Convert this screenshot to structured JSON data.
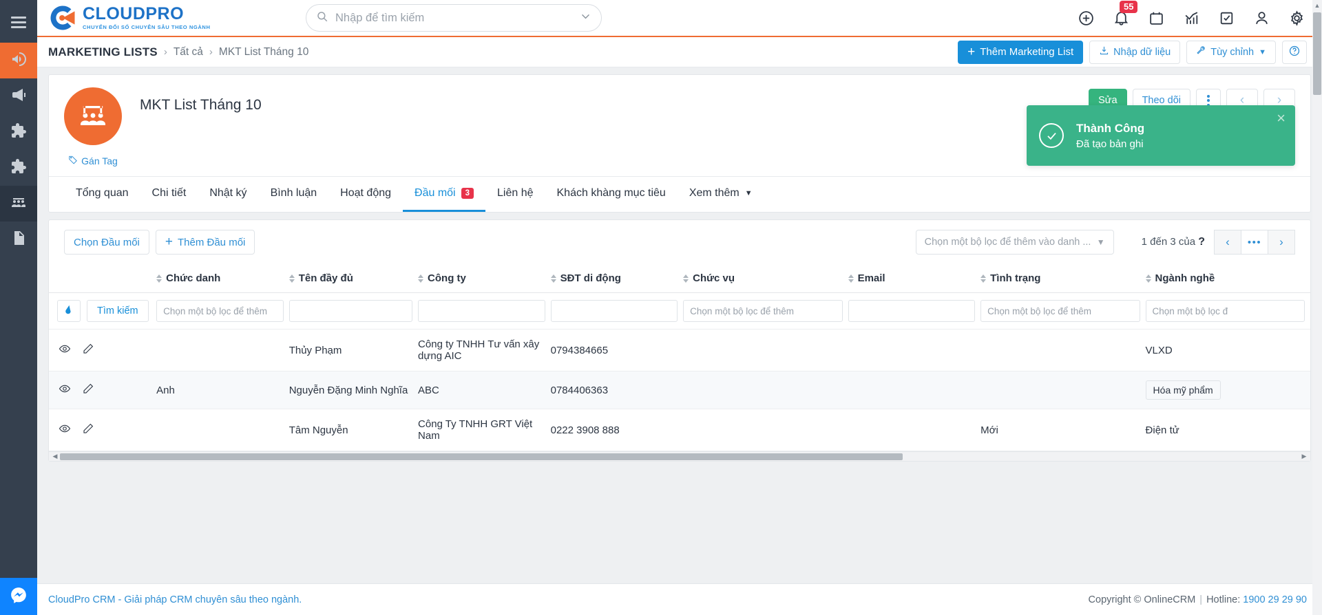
{
  "brand": {
    "name": "CLOUDPRO",
    "tagline": "CHUYỂN ĐỔI SỐ CHUYÊN SÂU THEO NGÀNH",
    "accent": "#ef6c32",
    "blue": "#188fd9"
  },
  "search": {
    "placeholder": "Nhập để tìm kiếm",
    "icon": "search-icon",
    "caret": "chevron-down-icon"
  },
  "topbar_icons": [
    {
      "name": "add-circle-icon",
      "label": ""
    },
    {
      "name": "notifications-bell-icon",
      "label": "",
      "badge": "55"
    },
    {
      "name": "calendar-icon",
      "label": ""
    },
    {
      "name": "analytics-chart-icon",
      "label": ""
    },
    {
      "name": "task-checkbox-icon",
      "label": ""
    },
    {
      "name": "user-account-icon",
      "label": ""
    },
    {
      "name": "settings-gear-icon",
      "label": ""
    }
  ],
  "breadcrumb": {
    "module": "MARKETING LISTS",
    "sep": "›",
    "all": "Tất cả",
    "current": "MKT List Tháng 10"
  },
  "breadcrumb_actions": {
    "add": "Thêm Marketing List",
    "import": "Nhập dữ liệu",
    "customize": "Tùy chỉnh",
    "help": "?"
  },
  "record": {
    "title": "MKT List Tháng 10",
    "tag_label": "Gán Tag",
    "avatar_icon": "marketing-list-group-icon",
    "actions": {
      "edit": "Sửa",
      "follow": "Theo dõi",
      "more": "⋮",
      "prev": "‹",
      "next": "›"
    }
  },
  "toast": {
    "title": "Thành Công",
    "message": "Đã tạo bản ghi",
    "close": "×",
    "color": "#3ab389"
  },
  "tabs": [
    {
      "label": "Tổng quan",
      "count": "",
      "active": false
    },
    {
      "label": "Chi tiết",
      "count": "",
      "active": false
    },
    {
      "label": "Nhật ký",
      "count": "",
      "active": false
    },
    {
      "label": "Bình luận",
      "count": "",
      "active": false
    },
    {
      "label": "Hoạt động",
      "count": "",
      "active": false
    },
    {
      "label": "Đầu mối",
      "count": "3",
      "active": true
    },
    {
      "label": "Liên hệ",
      "count": "",
      "active": false
    },
    {
      "label": "Khách khàng mục tiêu",
      "count": "",
      "active": false
    },
    {
      "label": "Xem thêm",
      "count": "",
      "active": false,
      "caret": true
    }
  ],
  "list_toolbar": {
    "select_lead": "Chọn Đầu mối",
    "add_lead": "Thêm Đầu mối",
    "filter_placeholder": "Chọn một bộ lọc để thêm vào danh ...",
    "pager_text_pre": "1 đến 3 của",
    "pager_total": "?",
    "pager_prev": "‹",
    "pager_mid": "•••",
    "pager_next": "›"
  },
  "table": {
    "columns": [
      {
        "key": "actions",
        "label": "",
        "sortable": false
      },
      {
        "key": "chuc_danh",
        "label": "Chức danh",
        "sortable": true
      },
      {
        "key": "ten_day_du",
        "label": "Tên đầy đủ",
        "sortable": true
      },
      {
        "key": "cong_ty",
        "label": "Công ty",
        "sortable": true
      },
      {
        "key": "sdt",
        "label": "SĐT di động",
        "sortable": true
      },
      {
        "key": "chuc_vu",
        "label": "Chức vụ",
        "sortable": true
      },
      {
        "key": "email",
        "label": "Email",
        "sortable": true
      },
      {
        "key": "tinh_trang",
        "label": "Tình trạng",
        "sortable": true
      },
      {
        "key": "nganh_nghe",
        "label": "Ngành nghề",
        "sortable": true
      }
    ],
    "filter_row": {
      "clear_icon": "eraser-icon",
      "search_label": "Tìm kiếm",
      "chuc_danh": "Chọn một bộ lọc để thêm",
      "ten_day_du": "",
      "cong_ty": "",
      "sdt": "",
      "chuc_vu": "Chọn một bộ lọc để thêm",
      "email": "",
      "tinh_trang": "Chọn một bộ lọc để thêm",
      "nganh_nghe": "Chọn một bộ lọc đ"
    },
    "rows": [
      {
        "chuc_danh": "",
        "ten_day_du": "Thủy Phạm",
        "cong_ty": "Công ty TNHH Tư vấn xây dựng AIC",
        "sdt": "0794384665",
        "chuc_vu": "",
        "email": "",
        "tinh_trang": "",
        "nganh_nghe": "VLXD",
        "nganh_nghe_chip": false
      },
      {
        "chuc_danh": "Anh",
        "ten_day_du": "Nguyễn Đặng Minh Nghĩa",
        "cong_ty": "ABC",
        "sdt": "0784406363",
        "chuc_vu": "",
        "email": "",
        "tinh_trang": "",
        "nganh_nghe": "Hóa mỹ phẩm",
        "nganh_nghe_chip": true
      },
      {
        "chuc_danh": "",
        "ten_day_du": "Tâm Nguyễn",
        "cong_ty": "Công Ty TNHH GRT Việt Nam",
        "sdt": "0222 3908 888",
        "chuc_vu": "",
        "email": "",
        "tinh_trang": "Mới",
        "nganh_nghe": "Điện tử",
        "nganh_nghe_chip": false
      }
    ],
    "row_action_icons": [
      "eye-view-icon",
      "pencil-edit-icon"
    ]
  },
  "footer": {
    "left": "CloudPro CRM - Giải pháp CRM chuyên sâu theo ngành.",
    "copyright": "Copyright © OnlineCRM",
    "sep": "|",
    "hotline_label": "Hotline:",
    "hotline": "1900 29 29 90"
  },
  "rail": {
    "items": [
      {
        "name": "sidebar-item-campaigns",
        "icon": "megaphone-icon",
        "active": false
      },
      {
        "name": "sidebar-item-broadcast",
        "icon": "speaker-icon",
        "active": false
      },
      {
        "name": "sidebar-item-modules",
        "icon": "puzzle-icon",
        "active": false
      },
      {
        "name": "sidebar-item-extensions",
        "icon": "puzzle-alt-icon",
        "active": false
      },
      {
        "name": "sidebar-item-marketing-lists",
        "icon": "group-people-icon",
        "active": true
      },
      {
        "name": "sidebar-item-documents",
        "icon": "document-icon",
        "active": false
      }
    ],
    "chat_icon": "messenger-chat-icon"
  }
}
